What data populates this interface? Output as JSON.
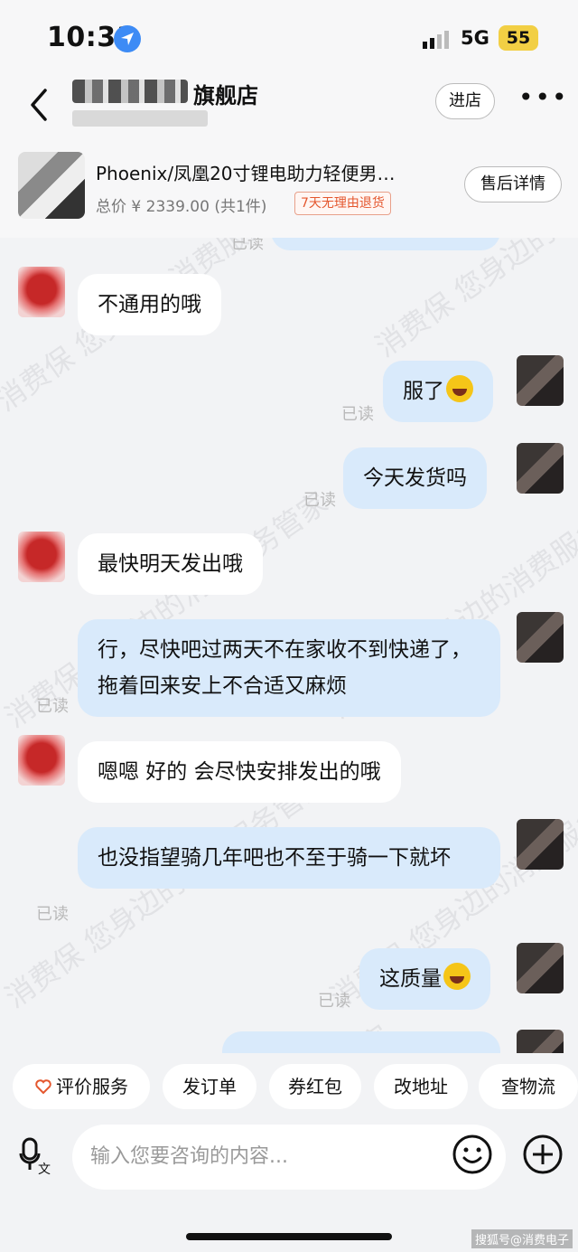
{
  "status_bar": {
    "time": "10:31",
    "network": "5G",
    "battery": "55"
  },
  "header": {
    "shop_name": "旗舰店",
    "enter_shop": "进店"
  },
  "product": {
    "title": "Phoenix/凤凰20寸锂电助力轻便男…",
    "price": "总价 ¥ 2339.00 (共1件)",
    "tag": "7天无理由退货",
    "aftersale": "售后详情"
  },
  "read_label": "已读",
  "messages": [
    {
      "from": "them",
      "text": "不通用的哦"
    },
    {
      "from": "me",
      "text": "服了"
    },
    {
      "from": "me",
      "text": "今天发货吗"
    },
    {
      "from": "them",
      "text": "最快明天发出哦"
    },
    {
      "from": "me",
      "text": "行，尽快吧过两天不在家收不到快递了，拖着回来安上不合适又麻烦"
    },
    {
      "from": "them",
      "text": "嗯嗯 好的  会尽快安排发出的哦"
    },
    {
      "from": "me",
      "text": "也没指望骑几年吧也不至于骑一下就坏"
    },
    {
      "from": "me",
      "text": "这质量"
    }
  ],
  "quick_actions": [
    "评价服务",
    "发订单",
    "券红包",
    "改地址",
    "查物流"
  ],
  "input": {
    "placeholder": "输入您要咨询的内容..."
  },
  "watermark": "消费保 您身边的消费服务管家",
  "credit": "搜狐号@消费电子",
  "icons": [
    "location-arrow-icon",
    "signal-icon",
    "back-icon",
    "more-icon",
    "heart-icon",
    "voice-icon",
    "smile-icon",
    "plus-icon",
    "laughing-emoji-icon"
  ]
}
